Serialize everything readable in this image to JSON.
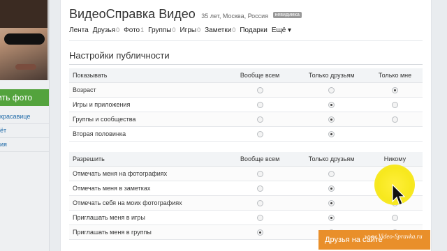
{
  "sidebar": {
    "photo_button": "ить фото",
    "links": [
      "красавице",
      "ёт",
      "ия"
    ]
  },
  "profile": {
    "name": "ВидеоСправка Видео",
    "meta": "35 лет, Москва, Россия",
    "badge": "невидимка"
  },
  "nav": [
    {
      "label": "Лента",
      "count": ""
    },
    {
      "label": "Друзья",
      "count": "0"
    },
    {
      "label": "Фото",
      "count": "1"
    },
    {
      "label": "Группы",
      "count": "0"
    },
    {
      "label": "Игры",
      "count": "0"
    },
    {
      "label": "Заметки",
      "count": "0"
    },
    {
      "label": "Подарки",
      "count": ""
    },
    {
      "label": "Ещё ▾",
      "count": ""
    }
  ],
  "section_title": "Настройки публичности",
  "show_table": {
    "headers": [
      "Показывать",
      "Вообще всем",
      "Только друзьям",
      "Только мне"
    ],
    "rows": [
      {
        "label": "Возраст",
        "selected": 3
      },
      {
        "label": "Игры и приложения",
        "selected": 2
      },
      {
        "label": "Группы и сообщества",
        "selected": 2
      },
      {
        "label": "Вторая половинка",
        "selected": 2,
        "no_third": true
      }
    ]
  },
  "allow_table": {
    "headers": [
      "Разрешить",
      "Вообще всем",
      "Только друзьям",
      "Никому"
    ],
    "rows": [
      {
        "label": "Отмечать меня на фотографиях",
        "selected": 3
      },
      {
        "label": "Отмечать меня в заметках",
        "selected": 2
      },
      {
        "label": "Отмечать себя на моих фотографиях",
        "selected": 2
      },
      {
        "label": "Приглашать меня в игры",
        "selected": 2
      },
      {
        "label": "Приглашать меня в группы",
        "selected": 1
      }
    ]
  },
  "friends_button": "Друзья на сайте",
  "watermark": "www.Video-Spravka.ru"
}
